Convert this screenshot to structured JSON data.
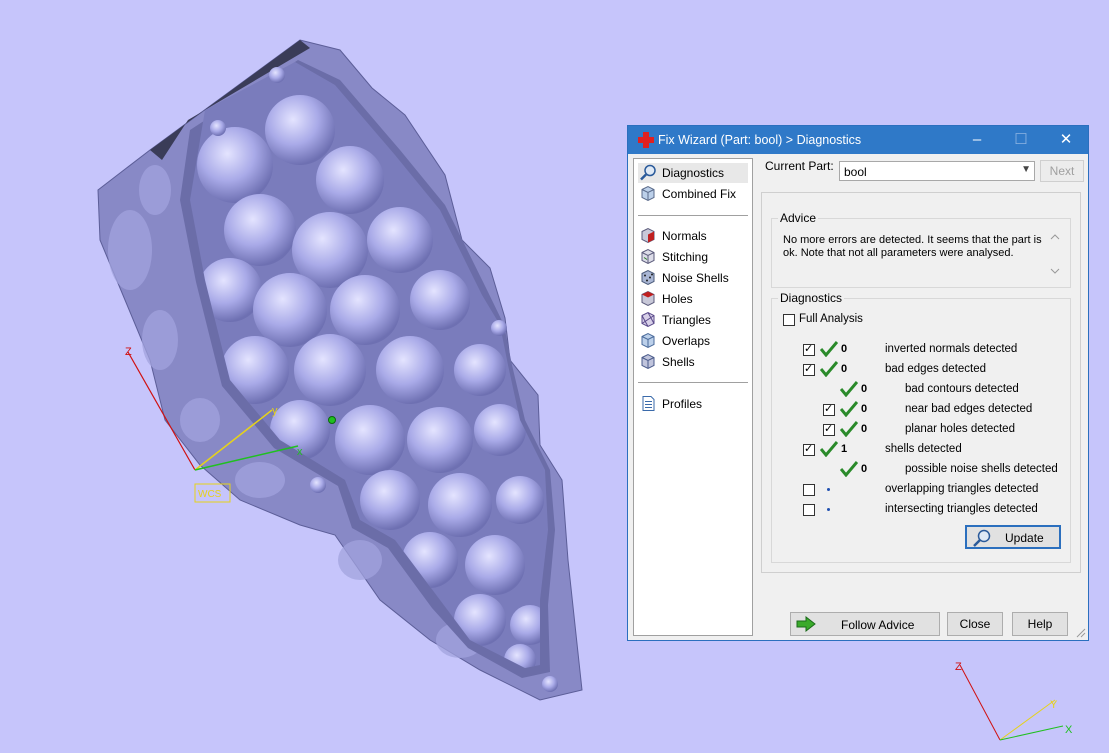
{
  "window": {
    "title": "Fix Wizard (Part: bool) > Diagnostics",
    "controls": {
      "minimize": "–",
      "maximize": "☐",
      "close": "✕"
    }
  },
  "nav": {
    "top_items": [
      {
        "label": "Diagnostics",
        "icon": "magnifier-icon",
        "selected": true
      },
      {
        "label": "Combined Fix",
        "icon": "cube-icon"
      }
    ],
    "tool_items": [
      {
        "label": "Normals",
        "icon": "normals-cube-icon"
      },
      {
        "label": "Stitching",
        "icon": "stitching-cube-icon"
      },
      {
        "label": "Noise Shells",
        "icon": "noise-shells-icon"
      },
      {
        "label": "Holes",
        "icon": "holes-cube-icon"
      },
      {
        "label": "Triangles",
        "icon": "triangles-cube-icon"
      },
      {
        "label": "Overlaps",
        "icon": "overlaps-cube-icon"
      },
      {
        "label": "Shells",
        "icon": "shells-cube-icon"
      }
    ],
    "profiles": {
      "label": "Profiles",
      "icon": "document-icon"
    }
  },
  "header": {
    "current_part_label": "Current Part:",
    "current_part_value": "bool",
    "next_label": "Next"
  },
  "advice": {
    "title": "Advice",
    "text": "No more errors are detected. It seems that the part is ok. Note that not all parameters were analysed."
  },
  "diagnostics": {
    "title": "Diagnostics",
    "full_analysis_label": "Full Analysis",
    "full_analysis_checked": false,
    "rows": [
      {
        "label": "inverted normals detected",
        "count": "0",
        "checkbox": true,
        "checked": true,
        "status": "ok",
        "indent": 0
      },
      {
        "label": "bad edges detected",
        "count": "0",
        "checkbox": true,
        "checked": true,
        "status": "ok",
        "indent": 0
      },
      {
        "label": "bad contours detected",
        "count": "0",
        "checkbox": false,
        "checked": false,
        "status": "ok",
        "indent": 1
      },
      {
        "label": "near bad edges detected",
        "count": "0",
        "checkbox": true,
        "checked": true,
        "status": "ok",
        "indent": 1
      },
      {
        "label": "planar holes detected",
        "count": "0",
        "checkbox": true,
        "checked": true,
        "status": "ok",
        "indent": 1
      },
      {
        "label": "shells detected",
        "count": "1",
        "checkbox": true,
        "checked": true,
        "status": "ok",
        "indent": 0
      },
      {
        "label": "possible noise shells detected",
        "count": "0",
        "checkbox": false,
        "checked": false,
        "status": "ok",
        "indent": 1
      },
      {
        "label": "overlapping triangles detected",
        "count": "",
        "checkbox": true,
        "checked": false,
        "status": "pending",
        "indent": 0
      },
      {
        "label": "intersecting triangles detected",
        "count": "",
        "checkbox": true,
        "checked": false,
        "status": "pending",
        "indent": 0
      }
    ],
    "update_label": "Update"
  },
  "footer": {
    "follow_advice_label": "Follow Advice",
    "close_label": "Close",
    "help_label": "Help"
  },
  "viewport": {
    "wcs_label": "WCS",
    "triad_labels": {
      "z": "Z",
      "y": "Y",
      "x": "X"
    },
    "colors": {
      "background": "#c6c5fb",
      "model": "#9a9be0",
      "model_dark": "#6a6ca8",
      "accent": "#2f79c8",
      "check": "#2a8a2a"
    }
  }
}
